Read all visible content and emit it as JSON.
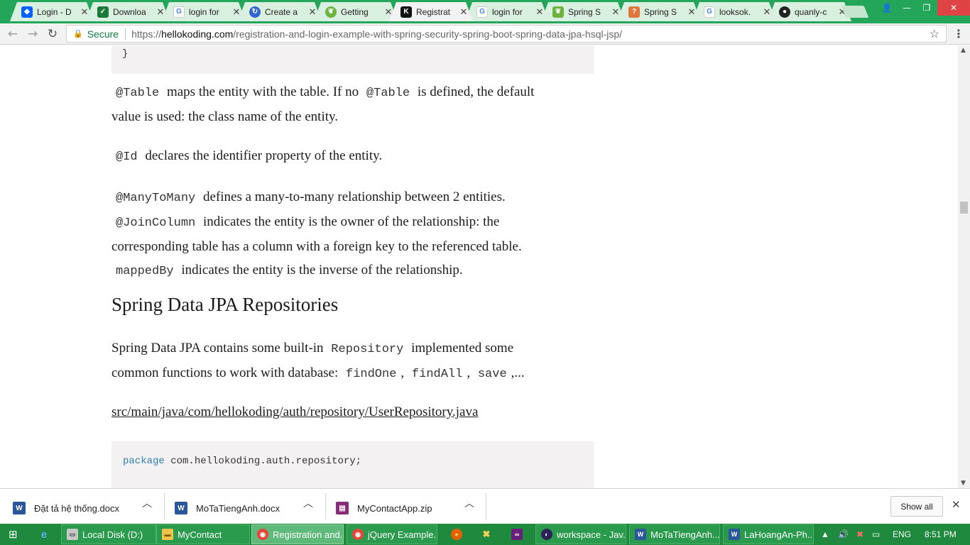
{
  "browser": {
    "tabs": [
      {
        "title": "Login - D",
        "icon": "dropbox-icon",
        "color": "#0061fe"
      },
      {
        "title": "Downloa",
        "icon": "check-icon",
        "color": "#1c7a39"
      },
      {
        "title": "login for",
        "icon": "google-icon",
        "color": "#4285f4"
      },
      {
        "title": "Create a",
        "icon": "refresh-circle-icon",
        "color": "#3366cc"
      },
      {
        "title": "Getting",
        "icon": "spring-leaf-icon",
        "color": "#6db33f"
      },
      {
        "title": "Registrat",
        "icon": "k-logo-icon",
        "color": "#111111"
      },
      {
        "title": "login for",
        "icon": "google-icon",
        "color": "#4285f4"
      },
      {
        "title": "Spring S",
        "icon": "spring-leaf-icon",
        "color": "#6db33f"
      },
      {
        "title": "Spring S",
        "icon": "question-icon",
        "color": "#e0763c"
      },
      {
        "title": "looksok.",
        "icon": "google-icon",
        "color": "#4285f4"
      },
      {
        "title": "quanly-c",
        "icon": "github-icon",
        "color": "#222222"
      }
    ],
    "address": {
      "secure_label": "Secure",
      "url_prefix": "https://",
      "url_host": "hellokoding.com",
      "url_path": "/registration-and-login-example-with-spring-security-spring-boot-spring-data-jpa-hsql-jsp/"
    }
  },
  "article": {
    "code_closing_brace": "}",
    "para_table": {
      "code1": "@Table",
      "text1": "maps the entity with the table. If no",
      "code2": "@Table",
      "text2": "is defined, the default",
      "text3": "value is used: the class name of the entity."
    },
    "para_id": {
      "code": "@Id",
      "text": "declares the identifier property of the entity."
    },
    "para_relations": {
      "code1": "@ManyToMany",
      "text1": "defines a many-to-many relationship between 2 entities.",
      "code2": "@JoinColumn",
      "text2": "indicates the entity is the owner of the relationship: the",
      "text3": "corresponding table has a column with a foreign key to the referenced table.",
      "code3": "mappedBy",
      "text4": "indicates the entity is the inverse of the relationship."
    },
    "heading": "Spring Data JPA Repositories",
    "para_repo": {
      "text1": "Spring Data JPA contains some built-in",
      "code1": "Repository",
      "text2": "implemented some",
      "text3": "common functions to work with database:",
      "code2": "findOne",
      "sep1": ",",
      "code3": "findAll",
      "sep2": ",",
      "code4": "save",
      "text4": ",..."
    },
    "file_link": "src/main/java/com/hellokoding/auth/repository/UserRepository.java",
    "code_package_kw": "package",
    "code_package_rest": "com.hellokoding.auth.repository;"
  },
  "downloads": {
    "items": [
      {
        "name": "Đặt tả hệ thống.docx",
        "icon": "word-doc-icon",
        "color": "#2b579a"
      },
      {
        "name": "MoTaTiengAnh.docx",
        "icon": "word-doc-icon",
        "color": "#2b579a"
      },
      {
        "name": "MyContactApp.zip",
        "icon": "winrar-archive-icon",
        "color": "#8a2b78"
      }
    ],
    "show_all": "Show all"
  },
  "taskbar": {
    "buttons": [
      {
        "label": "Local Disk (D:)",
        "icon": "drive-icon"
      },
      {
        "label": "MyContact",
        "icon": "folder-icon"
      },
      {
        "label": "Registration and...",
        "icon": "chrome-icon"
      },
      {
        "label": "jQuery Example...",
        "icon": "chrome-icon"
      },
      {
        "label": "workspace - Jav...",
        "icon": "eclipse-icon"
      },
      {
        "label": "MoTaTiengAnh....",
        "icon": "word-icon"
      },
      {
        "label": "LaHoangAn-Ph...",
        "icon": "word-icon"
      }
    ],
    "language": "ENG",
    "time": "8:51 PM"
  }
}
